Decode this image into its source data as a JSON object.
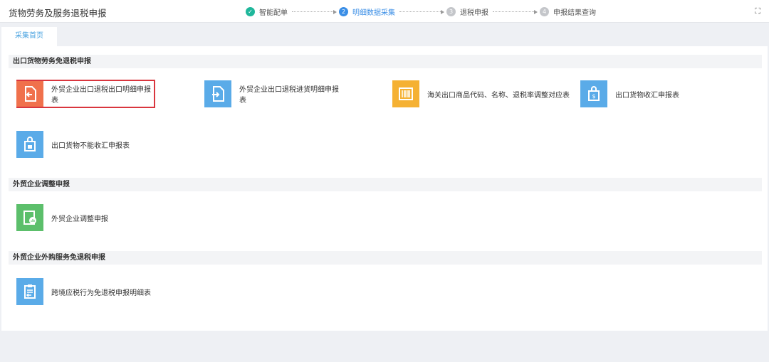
{
  "header": {
    "title": "货物劳务及服务退税申报",
    "fullscreen_icon": "fullscreen-icon",
    "steps": [
      {
        "num": "✓",
        "label": "智能配单",
        "state": "done"
      },
      {
        "num": "2",
        "label": "明细数据采集",
        "state": "active"
      },
      {
        "num": "3",
        "label": "退税申报",
        "state": "todo"
      },
      {
        "num": "4",
        "label": "申报结果查询",
        "state": "todo"
      }
    ]
  },
  "tabs": [
    {
      "label": "采集首页",
      "active": true
    }
  ],
  "sections": [
    {
      "title": "出口货物劳务免退税申报",
      "items": [
        {
          "label": "外贸企业出口退税出口明细申报表",
          "icon": "file-arrow-left-icon",
          "color": "#f0714c",
          "selected": true
        },
        {
          "label": "外贸企业出口退税进货明细申报表",
          "icon": "file-arrow-right-icon",
          "color": "#5aabe8"
        },
        {
          "label": "海关出口商品代码、名称、退税率调整对应表",
          "icon": "barcode-icon",
          "color": "#f5b133"
        },
        {
          "label": "出口货物收汇申报表",
          "icon": "shopping-bag-dollar-icon",
          "color": "#5aabe8"
        },
        {
          "label": "出口货物不能收汇申报表",
          "icon": "shopping-bag-lock-icon",
          "color": "#5aabe8"
        }
      ]
    },
    {
      "title": "外贸企业调整申报",
      "items": [
        {
          "label": "外贸企业调整申报",
          "icon": "report-chart-icon",
          "color": "#5cbf6b"
        }
      ]
    },
    {
      "title": "外贸企业外购服务免退税申报",
      "items": [
        {
          "label": "跨境应税行为免退税申报明细表",
          "icon": "clipboard-arrow-icon",
          "color": "#5aabe8"
        }
      ]
    }
  ]
}
